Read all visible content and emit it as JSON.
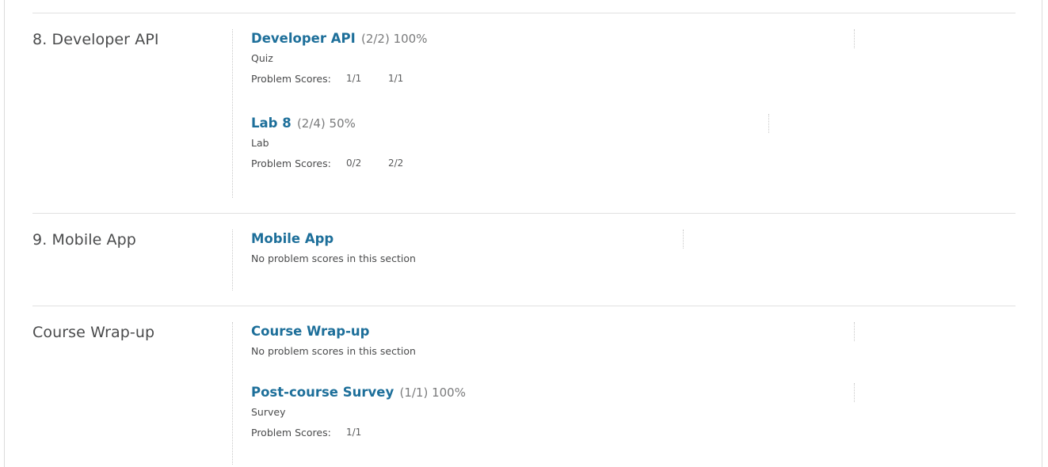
{
  "chapters": [
    {
      "title": "8. Developer API",
      "sections": [
        {
          "name": "Developer API",
          "score": "(2/2) 100%",
          "type": "Quiz",
          "scores_label": "Problem Scores:",
          "scores": [
            "1/1",
            "1/1"
          ]
        },
        {
          "name": "Lab 8",
          "score": "(2/4) 50%",
          "type": "Lab",
          "scores_label": "Problem Scores:",
          "scores": [
            "0/2",
            "2/2"
          ]
        }
      ]
    },
    {
      "title": "9. Mobile App",
      "sections": [
        {
          "name": "Mobile App",
          "no_scores_text": "No problem scores in this section"
        }
      ]
    },
    {
      "title": "Course Wrap-up",
      "sections": [
        {
          "name": "Course Wrap-up",
          "no_scores_text": "No problem scores in this section"
        },
        {
          "name": "Post-course Survey",
          "score": "(1/1) 100%",
          "type": "Survey",
          "scores_label": "Problem Scores:",
          "scores": [
            "1/1"
          ]
        }
      ]
    }
  ]
}
